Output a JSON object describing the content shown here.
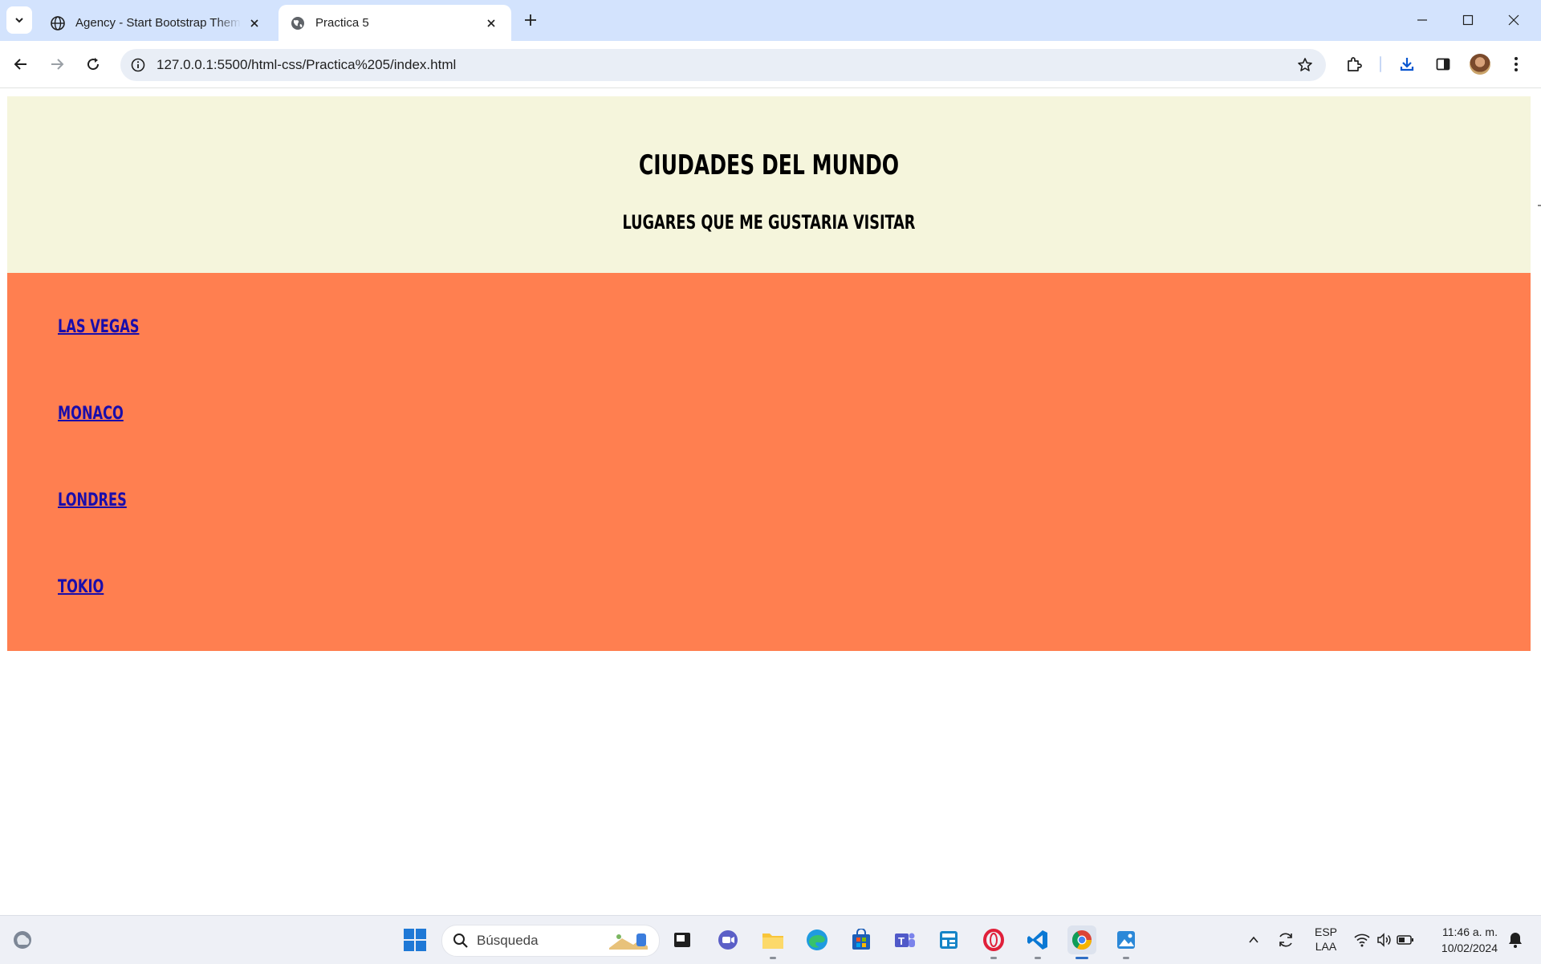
{
  "browser": {
    "tabs": [
      {
        "title": "Agency - Start Bootstrap Theme",
        "active": false,
        "icon": "globe-icon"
      },
      {
        "title": "Practica 5",
        "active": true,
        "icon": "globe-icon"
      }
    ],
    "url": "127.0.0.1:5500/html-css/Practica%205/index.html"
  },
  "page": {
    "title": "CIUDADES DEL MUNDO",
    "subtitle": "LUGARES QUE ME GUSTARIA VISITAR",
    "cities": [
      "LAS VEGAS",
      "MONACO",
      "LONDRES",
      "TOKIO"
    ],
    "colors": {
      "header_bg": "#f5f5dc",
      "section_bg": "#ff7f50",
      "link": "#1a0dab"
    }
  },
  "taskbar": {
    "search_placeholder": "Búsqueda",
    "language": "ESP",
    "keyboard": "LAA",
    "time": "11:46 a. m.",
    "date": "10/02/2024"
  }
}
